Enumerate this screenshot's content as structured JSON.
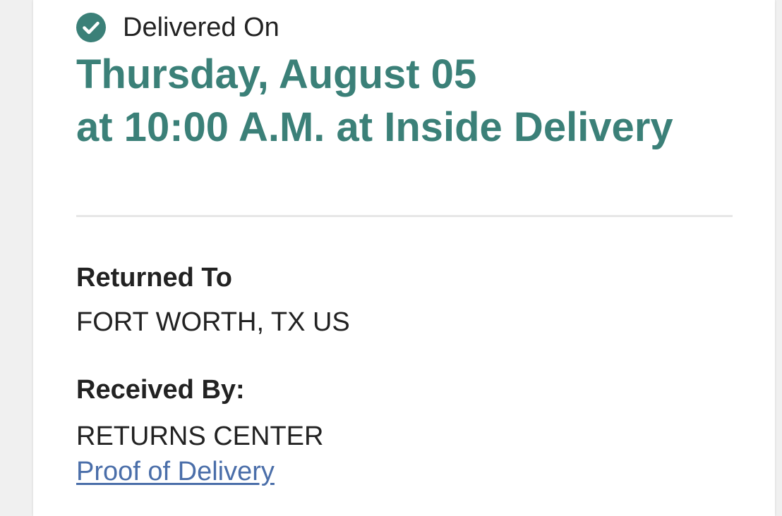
{
  "status": {
    "icon": "check-circle-icon",
    "label": "Delivered On"
  },
  "delivery": {
    "date": "Thursday, August 05",
    "time_location": "at 10:00 A.M. at Inside Delivery"
  },
  "returned_to": {
    "label": "Returned To",
    "value": "FORT WORTH, TX US"
  },
  "received_by": {
    "label": "Received By:",
    "value": "RETURNS CENTER"
  },
  "links": {
    "proof_of_delivery": "Proof of Delivery"
  },
  "colors": {
    "accent": "#3b8078",
    "link": "#4a6ea9",
    "text": "#222222",
    "divider": "#e6e6e6",
    "page_background": "#f0f0f0"
  }
}
